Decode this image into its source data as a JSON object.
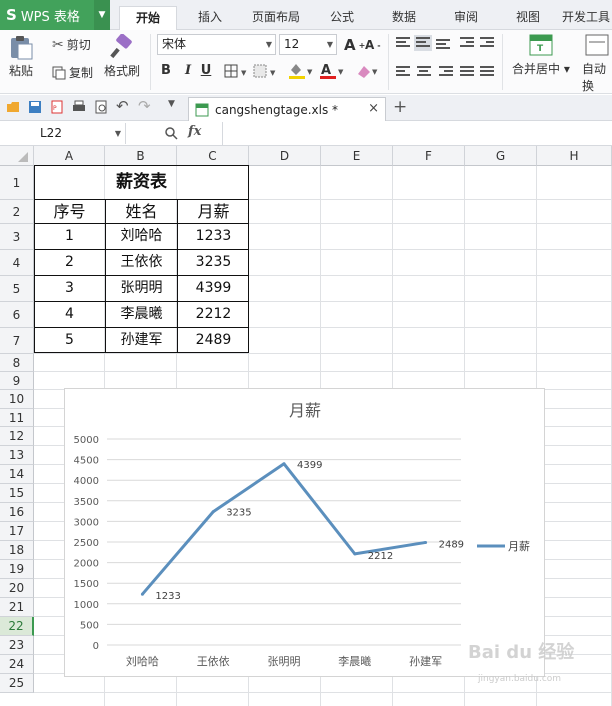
{
  "app": {
    "name": "WPS 表格",
    "accent": "#42a25b"
  },
  "tabs": [
    {
      "label": "开始",
      "active": true
    },
    {
      "label": "插入",
      "active": false
    },
    {
      "label": "页面布局",
      "active": false
    },
    {
      "label": "公式",
      "active": false
    },
    {
      "label": "数据",
      "active": false
    },
    {
      "label": "审阅",
      "active": false
    },
    {
      "label": "视图",
      "active": false
    },
    {
      "label": "开发工具",
      "active": false
    }
  ],
  "ribbon": {
    "paste": "粘贴",
    "cut": "剪切",
    "copy": "复制",
    "format_painter": "格式刷",
    "font_name": "宋体",
    "font_size": "12",
    "bold": "B",
    "italic": "I",
    "underline": "U",
    "merge_center": "合并居中",
    "auto_wrap": "自动换"
  },
  "document": {
    "filename": "cangshengtage.xls *"
  },
  "formula_bar": {
    "cell_ref": "L22",
    "fx": "fx",
    "content": ""
  },
  "columns": [
    "A",
    "B",
    "C",
    "D",
    "E",
    "F",
    "G",
    "H"
  ],
  "rows": [
    "1",
    "2",
    "3",
    "4",
    "5",
    "6",
    "7",
    "8",
    "9",
    "10",
    "11",
    "12",
    "13",
    "14",
    "15",
    "16",
    "17",
    "18",
    "19",
    "20",
    "21",
    "22",
    "23",
    "24",
    "25"
  ],
  "selected_row": "22",
  "table": {
    "title": "薪资表",
    "headers": [
      "序号",
      "姓名",
      "月薪"
    ],
    "rows": [
      [
        "1",
        "刘哈哈",
        "1233"
      ],
      [
        "2",
        "王依依",
        "3235"
      ],
      [
        "3",
        "张明明",
        "4399"
      ],
      [
        "4",
        "李晨曦",
        "2212"
      ],
      [
        "5",
        "孙建军",
        "2489"
      ]
    ]
  },
  "chart_data": {
    "type": "line",
    "title": "月薪",
    "categories": [
      "刘哈哈",
      "王依依",
      "张明明",
      "李晨曦",
      "孙建军"
    ],
    "series": [
      {
        "name": "月薪",
        "values": [
          1233,
          3235,
          4399,
          2212,
          2489
        ],
        "color": "#5b8fbd"
      }
    ],
    "yticks": [
      "0",
      "500",
      "1000",
      "1500",
      "2000",
      "2500",
      "3000",
      "3500",
      "4000",
      "4500",
      "5000"
    ],
    "ylim": [
      0,
      5000
    ],
    "data_labels": true,
    "legend": "right",
    "grid": true
  },
  "watermark": {
    "text": "Bai du 经验",
    "sub": "jingyan.baidu.com"
  }
}
